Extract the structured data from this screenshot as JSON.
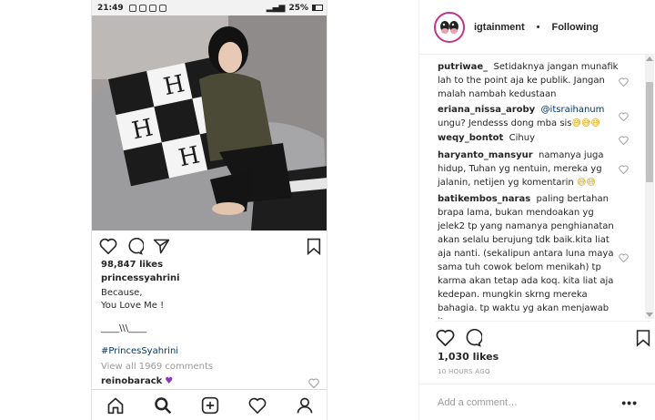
{
  "phone": {
    "status": {
      "time": "21:49",
      "battery": "25%"
    },
    "likes": "98,847 likes",
    "owner": "princessyahrini",
    "caption_lines": [
      "Because,",
      "You Love Me !"
    ],
    "divider": "____\\\\\\____",
    "hashtag": "#PrincesSyahrini",
    "view_all": "View all 1969 comments",
    "last_commenter": "reinobarack",
    "icons": [
      "heart-icon",
      "comment-icon",
      "share-icon",
      "bookmark-icon",
      "home-icon",
      "search-icon",
      "add-icon",
      "activity-heart-icon",
      "profile-icon"
    ]
  },
  "panel": {
    "username": "igtainment",
    "separator": "•",
    "follow_status": "Following",
    "comments": [
      {
        "user": "putriwae_",
        "text": "Setidaknya jangan munafik lah to the point aja ke publik. Jangan malah nambah kedustaan"
      },
      {
        "user": "eriana_nissa_aroby",
        "mention": "@itsraihanum",
        "text": "ungu? Jendesss dong mba sis",
        "emoji": "😅😅😅"
      },
      {
        "user": "weqy_bontot",
        "text": "Cihuy"
      },
      {
        "user": "haryanto_mansyur",
        "text": "namanya juga hidup, Tuhan yg nentuin, mereka yg jalanin, netijen yg komentarin",
        "emoji": "😅😅"
      },
      {
        "user": "batikembos_naras",
        "text": "paling bertahan brapa lama, bukan mendoakan yg jelek2 tp yang namanya penghianatan akan selalu berujung tdk baik.kita liat aja nanti. (sekalipun antara luna maya sama tuh cowok belom menikah) tp karma akan tetap ada koq. kita liat aja kedepan. mungkin skrng mereka bahagia. tp waktu yg akan menjawab itu semua"
      }
    ],
    "likes": "1,030 likes",
    "time_ago": "10 HOURS AGO",
    "add_comment_placeholder": "Add a comment…",
    "more_label": "•••"
  },
  "colors": {
    "link": "#003569",
    "muted": "#999999",
    "purple": "#8a3ab9",
    "avatar_ring": "#c13584"
  }
}
